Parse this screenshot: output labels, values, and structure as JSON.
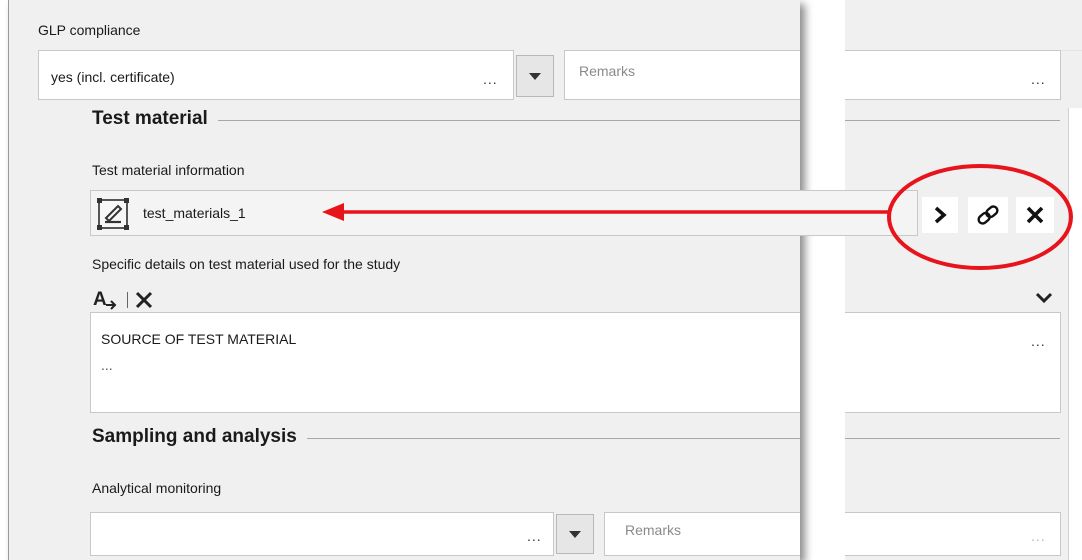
{
  "glp": {
    "label": "GLP compliance",
    "value": "yes (incl. certificate)",
    "ellipsis": "...",
    "remarks_placeholder": "Remarks",
    "remarks_ellipsis": "..."
  },
  "test_material": {
    "section_title": "Test material",
    "info_label": "Test material information",
    "link_value": "test_materials_1",
    "details_label": "Specific details on test material used for the study",
    "details_text_line1": "SOURCE OF TEST MATERIAL",
    "details_text_line2": "...",
    "details_ellipsis": "..."
  },
  "sampling": {
    "section_title": "Sampling and analysis",
    "monitoring_label": "Analytical monitoring",
    "value": "",
    "ellipsis": "...",
    "remarks_placeholder": "Remarks",
    "remarks_ellipsis": "..."
  },
  "annotation": {
    "color": "#e8141b"
  },
  "icons": {
    "link_actions": [
      "chevron-right-icon",
      "link-icon",
      "close-icon"
    ],
    "toolbar": [
      "text-format-icon",
      "close-icon"
    ]
  }
}
